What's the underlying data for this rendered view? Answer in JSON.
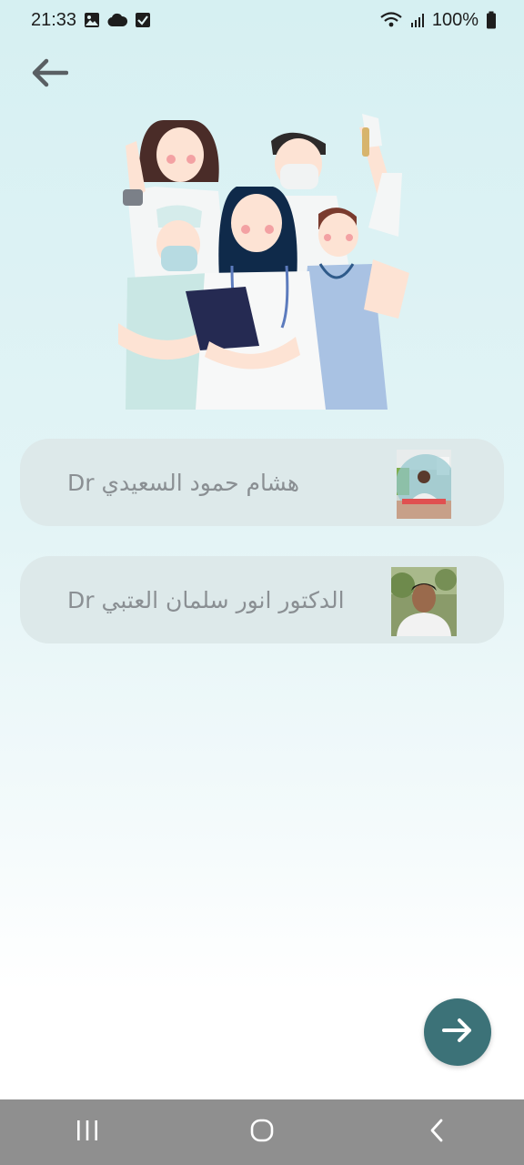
{
  "status_bar": {
    "time": "21:33",
    "battery": "100%"
  },
  "doctors": [
    {
      "name": "هشام حمود السعيدي Dr"
    },
    {
      "name": "الدكتور انور  سلمان العتبي Dr"
    }
  ],
  "icons": {
    "back": "arrow-left-icon",
    "next": "arrow-right-icon",
    "recents": "recents-icon",
    "home": "home-icon",
    "nav_back": "chevron-left-icon"
  },
  "colors": {
    "fab": "#3c7278",
    "card": "#dde9ea",
    "nav_bar": "#8f8f8f"
  }
}
